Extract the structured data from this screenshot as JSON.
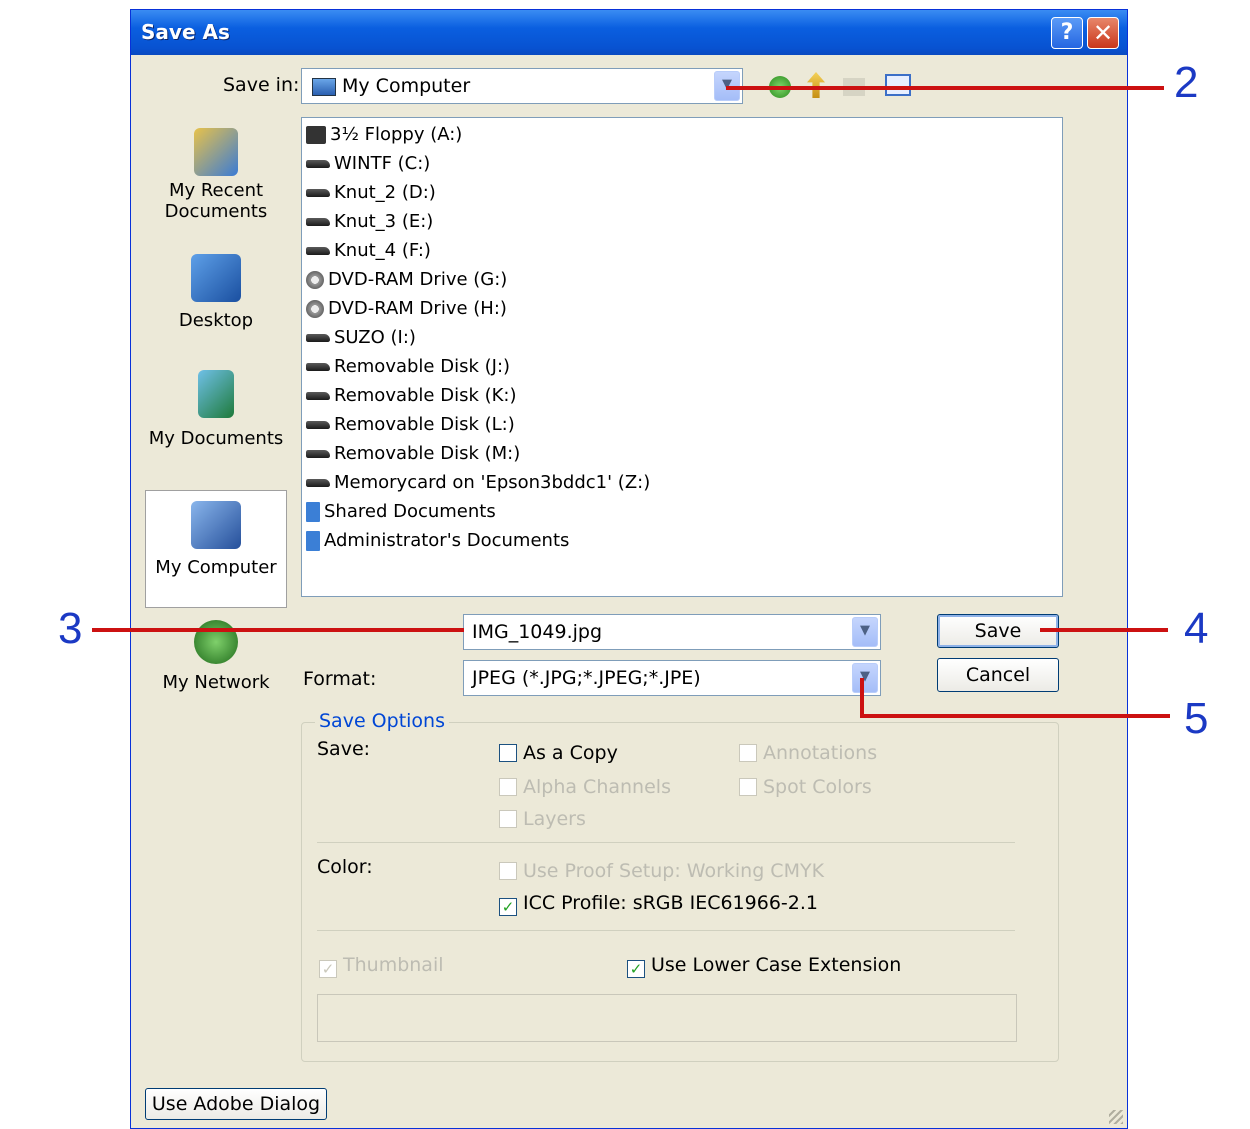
{
  "window": {
    "title": "Save As",
    "help_glyph": "?",
    "close_glyph": "✕"
  },
  "save_in": {
    "label": "Save in:",
    "value": "My Computer"
  },
  "places": [
    {
      "label": "My Recent\nDocuments"
    },
    {
      "label": "Desktop"
    },
    {
      "label": "My Documents"
    },
    {
      "label": "My Computer"
    },
    {
      "label": "My Network"
    }
  ],
  "files": [
    {
      "name": "3½ Floppy (A:)",
      "icon": "floppy"
    },
    {
      "name": "WINTF (C:)",
      "icon": "drive"
    },
    {
      "name": "Knut_2 (D:)",
      "icon": "drive"
    },
    {
      "name": "Knut_3 (E:)",
      "icon": "drive"
    },
    {
      "name": "Knut_4 (F:)",
      "icon": "drive"
    },
    {
      "name": "DVD-RAM Drive (G:)",
      "icon": "cdrom"
    },
    {
      "name": "DVD-RAM Drive (H:)",
      "icon": "cdrom"
    },
    {
      "name": "SUZO (I:)",
      "icon": "drive"
    },
    {
      "name": "Removable Disk (J:)",
      "icon": "drive"
    },
    {
      "name": "Removable Disk (K:)",
      "icon": "drive"
    },
    {
      "name": "Removable Disk (L:)",
      "icon": "drive"
    },
    {
      "name": "Removable Disk (M:)",
      "icon": "drive"
    },
    {
      "name": "Memorycard on 'Epson3bddc1' (Z:)",
      "icon": "drive"
    },
    {
      "name": "Shared Documents",
      "icon": "folder"
    },
    {
      "name": "Administrator's Documents",
      "icon": "folder"
    }
  ],
  "file_name": {
    "value": "IMG_1049.jpg"
  },
  "format": {
    "label": "Format:",
    "value": "JPEG (*.JPG;*.JPEG;*.JPE)"
  },
  "buttons": {
    "save": "Save",
    "cancel": "Cancel",
    "adobe": "Use Adobe Dialog"
  },
  "save_options": {
    "legend": "Save Options",
    "save_label": "Save:",
    "as_a_copy": "As a Copy",
    "alpha_channels": "Alpha Channels",
    "layers": "Layers",
    "annotations": "Annotations",
    "spot_colors": "Spot Colors",
    "color_label": "Color:",
    "use_proof_setup": "Use Proof Setup:  Working CMYK",
    "icc_profile": "ICC Profile:  sRGB IEC61966-2.1",
    "thumbnail": "Thumbnail",
    "lower_case_ext": "Use Lower Case Extension"
  },
  "callouts": {
    "n2": "2",
    "n3": "3",
    "n4": "4",
    "n5": "5"
  },
  "colors": {
    "callout_line": "#cc1111",
    "callout_number": "#1b39c4",
    "titlebar": "#0852d1"
  }
}
